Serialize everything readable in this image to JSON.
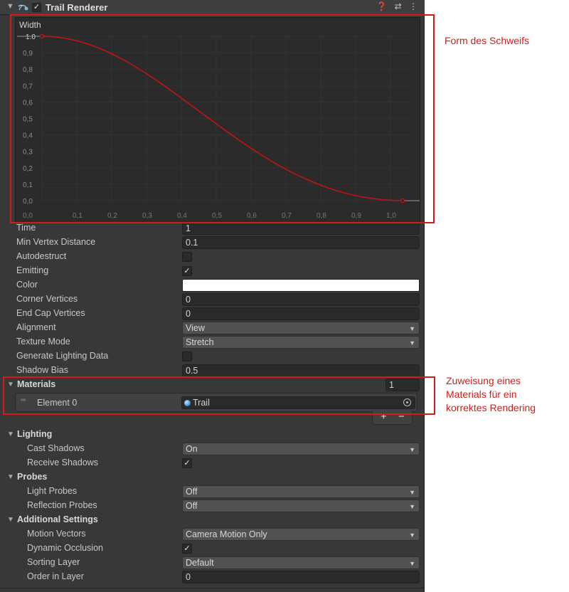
{
  "component": {
    "title": "Trail Renderer",
    "enabled": "✓",
    "header_icons": [
      "help-icon",
      "presets-icon",
      "kebab-menu-icon"
    ]
  },
  "curve": {
    "label": "Width",
    "value_label": "1.0",
    "y_ticks": [
      "0,9",
      "0,8",
      "0,7",
      "0,6",
      "0,5",
      "0,4",
      "0,3",
      "0,2",
      "0,1",
      "0,0"
    ],
    "x_ticks": [
      "0,0",
      "0,1",
      "0,2",
      "0,3",
      "0,4",
      "0,5",
      "0,6",
      "0,7",
      "0,8",
      "0,9",
      "1,0"
    ],
    "curve_color": "#c81414"
  },
  "props": {
    "time": {
      "label": "Time",
      "value": "1"
    },
    "min_vertex_distance": {
      "label": "Min Vertex Distance",
      "value": "0.1"
    },
    "autodestruct": {
      "label": "Autodestruct"
    },
    "emitting": {
      "label": "Emitting",
      "check": "✓"
    },
    "color": {
      "label": "Color",
      "value": "#ffffff"
    },
    "corner_vertices": {
      "label": "Corner Vertices",
      "value": "0"
    },
    "end_cap_vertices": {
      "label": "End Cap Vertices",
      "value": "0"
    },
    "alignment": {
      "label": "Alignment",
      "value": "View"
    },
    "texture_mode": {
      "label": "Texture Mode",
      "value": "Stretch"
    },
    "generate_lighting_data": {
      "label": "Generate Lighting Data"
    },
    "shadow_bias": {
      "label": "Shadow Bias",
      "value": "0.5"
    }
  },
  "materials": {
    "label": "Materials",
    "size": "1",
    "element_label": "Element 0",
    "element_value": "Trail",
    "add": "+",
    "remove": "−"
  },
  "lighting": {
    "label": "Lighting",
    "cast_shadows": {
      "label": "Cast Shadows",
      "value": "On"
    },
    "receive_shadows": {
      "label": "Receive Shadows",
      "check": "✓"
    }
  },
  "probes": {
    "label": "Probes",
    "light_probes": {
      "label": "Light Probes",
      "value": "Off"
    },
    "reflection_probes": {
      "label": "Reflection Probes",
      "value": "Off"
    }
  },
  "additional": {
    "label": "Additional Settings",
    "motion_vectors": {
      "label": "Motion Vectors",
      "value": "Camera Motion Only"
    },
    "dynamic_occlusion": {
      "label": "Dynamic Occlusion",
      "check": "✓"
    },
    "sorting_layer": {
      "label": "Sorting Layer",
      "value": "Default"
    },
    "order_in_layer": {
      "label": "Order in Layer",
      "value": "0"
    }
  },
  "annotations": {
    "curve_note": "Form des Schweifs",
    "material_note": [
      "Zuweisung eines",
      "Materials für ein",
      "korrektes Rendering"
    ],
    "color": "#d21c1c"
  }
}
